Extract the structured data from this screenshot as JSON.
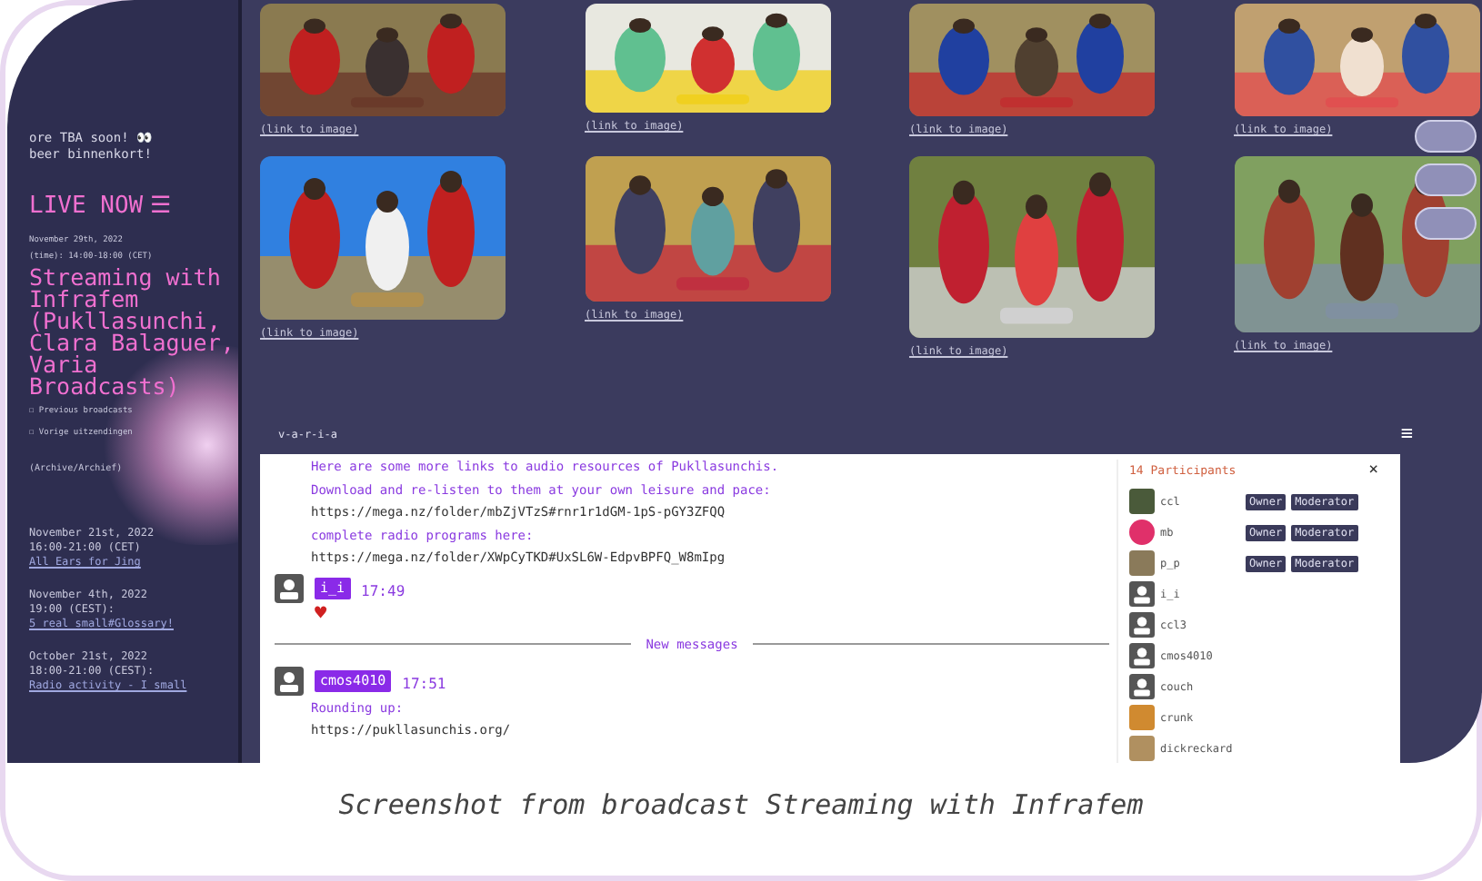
{
  "sidebar": {
    "teaser": [
      "ore TBA soon! 👀",
      "beer binnenkort!"
    ],
    "live": {
      "label": "LIVE NOW",
      "menu_icon": "☰"
    },
    "current": {
      "date": "November 29th, 2022",
      "time": "(time): 14:00-18:00 (CET)",
      "title": "Streaming with Infrafem (Pukllasunchi, Clara Balaguer, Varia Broadcasts)",
      "links": [
        "☐ Previous broadcasts",
        "☐ Vorige uitzendingen"
      ],
      "archive": "(Archive/Archief)"
    },
    "past": [
      {
        "date": "November 21st, 2022",
        "time": "16:00-21:00 (CET)",
        "title": "All Ears for Jing"
      },
      {
        "date": "November 4th, 2022",
        "time": "19:00 (CEST):",
        "title": "5 real small#Glossary!"
      },
      {
        "date": "October 21st, 2022",
        "time": "18:00-21:00 (CEST):",
        "title": "Radio activity - I small"
      }
    ]
  },
  "gallery": [
    {
      "link": "(link to image)"
    },
    {
      "link": "(link to image)"
    },
    {
      "link": "(link to image)"
    },
    {
      "link": "(link to image)"
    },
    {
      "link": "(link to image)"
    },
    {
      "link": "(link to image)"
    },
    {
      "link": "(link to image)"
    },
    {
      "link": "(link to image)"
    }
  ],
  "chat": {
    "title": "v-a-r-i-a",
    "menu_icon": "≡",
    "lines": [
      {
        "kind": "text",
        "text": "Here are some more links to audio resources of Pukllasunchis."
      },
      {
        "kind": "text",
        "text": "Download and re-listen to them at your own leisure and pace:"
      },
      {
        "kind": "link",
        "text": "https://mega.nz/folder/mbZjVTzS#rnr1r1dGM-1pS-pGY3ZFQQ"
      },
      {
        "kind": "text",
        "text": "complete radio programs here:"
      },
      {
        "kind": "link",
        "text": "https://mega.nz/folder/XWpCyTKD#UxSL6W-EdpvBPFQ_W8mIpg"
      }
    ],
    "messages": [
      {
        "user": "i_i",
        "time": "17:49",
        "reaction": "♥"
      },
      {
        "divider": "New messages"
      },
      {
        "user": "cmos4010",
        "time": "17:51",
        "lines": [
          {
            "kind": "text",
            "text": "Rounding up:"
          },
          {
            "kind": "link",
            "text": "https://pukllasunchis.org/"
          }
        ]
      }
    ]
  },
  "participants": {
    "title": "14 Participants",
    "close": "×",
    "items": [
      {
        "name": "ccl",
        "color": "#4a5a3a",
        "roles": [
          "Owner",
          "Moderator"
        ]
      },
      {
        "name": "mb",
        "kind": "emoji",
        "color": "#e0306a",
        "roles": [
          "Owner",
          "Moderator"
        ]
      },
      {
        "name": "p_p",
        "color": "#8a7a5a",
        "roles": [
          "Owner",
          "Moderator"
        ]
      },
      {
        "name": "i_i",
        "kind": "default"
      },
      {
        "name": "ccl3",
        "kind": "default"
      },
      {
        "name": "cmos4010",
        "kind": "default"
      },
      {
        "name": "couch",
        "kind": "default"
      },
      {
        "name": "crunk",
        "color": "#d08a30"
      },
      {
        "name": "dickreckard",
        "color": "#b09060"
      }
    ]
  },
  "caption": "Screenshot from broadcast Streaming with Infrafem"
}
